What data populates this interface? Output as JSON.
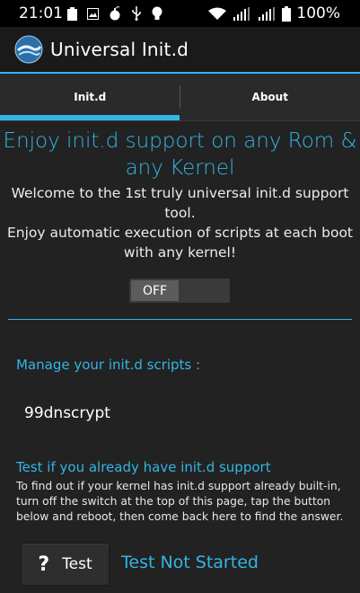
{
  "status_bar": {
    "time": "21:01",
    "battery_text": "100%",
    "left_icons": [
      "clipboard-icon",
      "image-icon",
      "bomb-icon",
      "usb-icon",
      "bulb-icon"
    ],
    "right_icons": [
      "wifi-icon",
      "signal-icon",
      "signal-icon",
      "battery-icon"
    ]
  },
  "app_bar": {
    "title": "Universal Init.d"
  },
  "tabs": [
    {
      "label": "Init.d",
      "selected": true
    },
    {
      "label": "About",
      "selected": false
    }
  ],
  "main": {
    "headline": "Enjoy init.d support on any Rom & any Kernel",
    "welcome": "Welcome to the 1st truly universal init.d support tool.\nEnjoy automatic execution of scripts at each boot with any kernel!",
    "toggle_label": "OFF",
    "manage_label": "Manage your init.d scripts :",
    "scripts": [
      "99dnscrypt"
    ],
    "test_title": "Test if you already have init.d support",
    "test_help": "To find out if your kernel has init.d support already built-in, turn off the switch at the top of this page, tap the button below and reboot, then come back here to find the answer.",
    "test_button_label": "Test",
    "test_status": "Test Not Started"
  },
  "colors": {
    "accent": "#33b5e5",
    "background": "#222222"
  }
}
